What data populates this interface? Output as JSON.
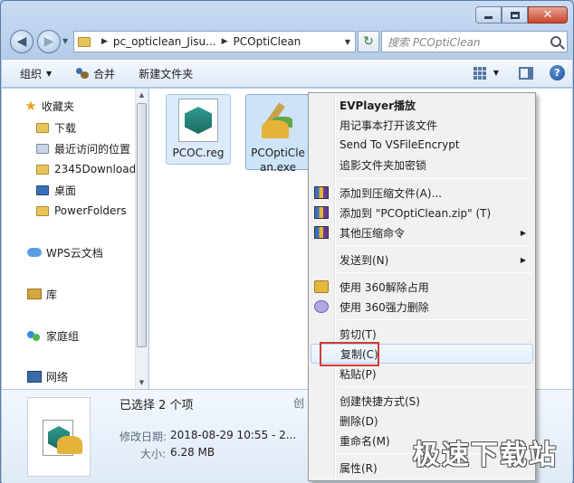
{
  "breadcrumb": [
    "pc_opticlean_Jisu...",
    "PCOptiClean"
  ],
  "search": {
    "placeholder": "搜索 PCOptiClean"
  },
  "toolbar": {
    "organize": "组织",
    "share": "合并",
    "new_folder": "新建文件夹"
  },
  "caption": {
    "close": "✕"
  },
  "nav": {
    "favorites": "收藏夹",
    "items": [
      "下载",
      "最近访问的位置",
      "2345Downloads",
      "桌面",
      "PowerFolders"
    ],
    "wps": "WPS云文档",
    "library": "库",
    "homegroup": "家庭组",
    "network": "网络"
  },
  "files": [
    {
      "name": "PCOC.reg",
      "icon": "registry-file-icon"
    },
    {
      "name": "PCOptiClean.exe",
      "icon": "broom-app-icon"
    }
  ],
  "details": {
    "selected": "已选择 2 个项",
    "modified_label": "修改日期:",
    "modified_value": "2018-08-29 10:55 - 2...",
    "size_label": "大小:",
    "size_value": "6.28 MB",
    "created_label": "创"
  },
  "context_menu": {
    "items": [
      {
        "label": "EVPlayer播放",
        "bold": true
      },
      {
        "label": "用记事本打开该文件"
      },
      {
        "label": "Send To VSFileEncrypt"
      },
      {
        "label": "追影文件夹加密锁"
      },
      {
        "label": "添加到压缩文件(A)...",
        "icon": "zip-icon"
      },
      {
        "label": "添加到 \"PCOptiClean.zip\" (T)",
        "icon": "zip-icon"
      },
      {
        "label": "其他压缩命令",
        "icon": "zip-icon",
        "submenu": true
      },
      {
        "label": "发送到(N)",
        "submenu": true
      },
      {
        "label": "使用 360解除占用",
        "icon": "unlock-icon"
      },
      {
        "label": "使用 360强力删除",
        "icon": "shred-icon"
      },
      {
        "label": "剪切(T)"
      },
      {
        "label": "复制(C)",
        "highlighted": true
      },
      {
        "label": "粘贴(P)"
      },
      {
        "label": "创建快捷方式(S)"
      },
      {
        "label": "删除(D)"
      },
      {
        "label": "重命名(M)"
      },
      {
        "label": "属性(R)"
      }
    ]
  },
  "watermark": "极速下载站",
  "colors": {
    "highlight_box": "#d33a35",
    "selection": "#cde3f8"
  }
}
